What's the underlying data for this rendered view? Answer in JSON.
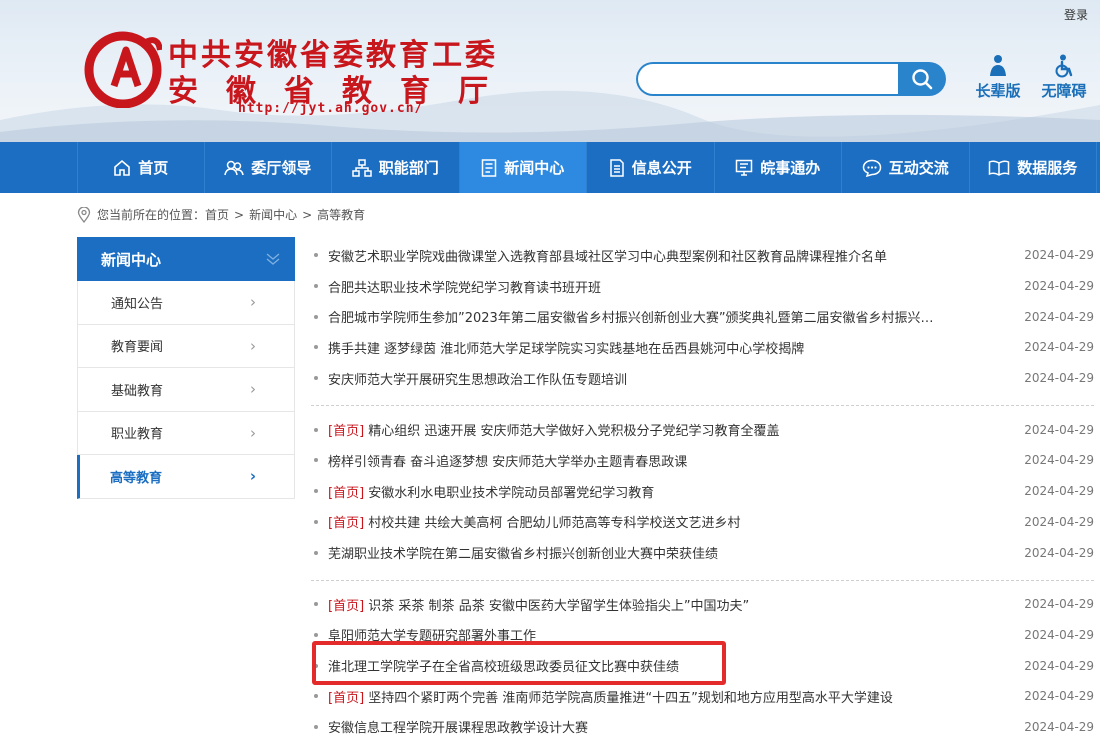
{
  "header": {
    "login": "登录",
    "title_line1": "中共安徽省委教育工委",
    "title_line2": "安徽省教育厅",
    "url": "http://jyt.ah.gov.cn/",
    "search_placeholder": "",
    "tools": {
      "elder": "长辈版",
      "access": "无障碍"
    }
  },
  "nav": [
    {
      "label": "首页",
      "icon": "home-icon"
    },
    {
      "label": "委厅领导",
      "icon": "people-icon"
    },
    {
      "label": "职能部门",
      "icon": "org-chart-icon"
    },
    {
      "label": "新闻中心",
      "icon": "document-icon",
      "active": true
    },
    {
      "label": "信息公开",
      "icon": "file-list-icon"
    },
    {
      "label": "皖事通办",
      "icon": "monitor-icon"
    },
    {
      "label": "互动交流",
      "icon": "chat-icon"
    },
    {
      "label": "数据服务",
      "icon": "book-icon"
    }
  ],
  "breadcrumb": {
    "prefix": "您当前所在的位置：",
    "items": [
      "首页",
      "新闻中心",
      "高等教育"
    ],
    "separator": ">"
  },
  "sidebar": {
    "title": "新闻中心",
    "items": [
      {
        "label": "通知公告"
      },
      {
        "label": "教育要闻"
      },
      {
        "label": "基础教育"
      },
      {
        "label": "职业教育"
      },
      {
        "label": "高等教育",
        "active": true
      }
    ]
  },
  "news": {
    "tag_label": "[首页]",
    "groups": [
      [
        {
          "title": "安徽艺术职业学院戏曲微课堂入选教育部县域社区学习中心典型案例和社区教育品牌课程推介名单",
          "date": "2024-04-29",
          "tag": false
        },
        {
          "title": "合肥共达职业技术学院党纪学习教育读书班开班",
          "date": "2024-04-29",
          "tag": false
        },
        {
          "title": "合肥城市学院师生参加”2023年第二届安徽省乡村振兴创新创业大赛”颁奖典礼暨第二届安徽省乡村振兴…",
          "date": "2024-04-29",
          "tag": false
        },
        {
          "title": "携手共建 逐梦绿茵 淮北师范大学足球学院实习实践基地在岳西县姚河中心学校揭牌",
          "date": "2024-04-29",
          "tag": false
        },
        {
          "title": "安庆师范大学开展研究生思想政治工作队伍专题培训",
          "date": "2024-04-29",
          "tag": false
        }
      ],
      [
        {
          "title": "精心组织 迅速开展 安庆师范大学做好入党积极分子党纪学习教育全覆盖",
          "date": "2024-04-29",
          "tag": true
        },
        {
          "title": "榜样引领青春 奋斗追逐梦想 安庆师范大学举办主题青春思政课",
          "date": "2024-04-29",
          "tag": false
        },
        {
          "title": "安徽水利水电职业技术学院动员部署党纪学习教育",
          "date": "2024-04-29",
          "tag": true
        },
        {
          "title": "村校共建 共绘大美高柯 合肥幼儿师范高等专科学校送文艺进乡村",
          "date": "2024-04-29",
          "tag": true
        },
        {
          "title": "芜湖职业技术学院在第二届安徽省乡村振兴创新创业大赛中荣获佳绩",
          "date": "2024-04-29",
          "tag": false
        }
      ],
      [
        {
          "title": "识茶 采茶 制茶 品茶 安徽中医药大学留学生体验指尖上”中国功夫”",
          "date": "2024-04-29",
          "tag": true
        },
        {
          "title": "阜阳师范大学专题研究部署外事工作",
          "date": "2024-04-29",
          "tag": false
        },
        {
          "title": "淮北理工学院学子在全省高校班级思政委员征文比赛中获佳绩",
          "date": "2024-04-29",
          "tag": false
        },
        {
          "title": "坚持四个紧盯两个完善 淮南师范学院高质量推进“十四五”规划和地方应用型高水平大学建设",
          "date": "2024-04-29",
          "tag": true
        },
        {
          "title": "安徽信息工程学院开展课程思政教学设计大赛",
          "date": "2024-04-29",
          "tag": false
        }
      ]
    ]
  },
  "colors": {
    "brand_blue": "#1b6ec2",
    "nav_active": "#2e8ae0",
    "logo_red": "#c8161d",
    "highlight_red": "#e32b2b"
  }
}
